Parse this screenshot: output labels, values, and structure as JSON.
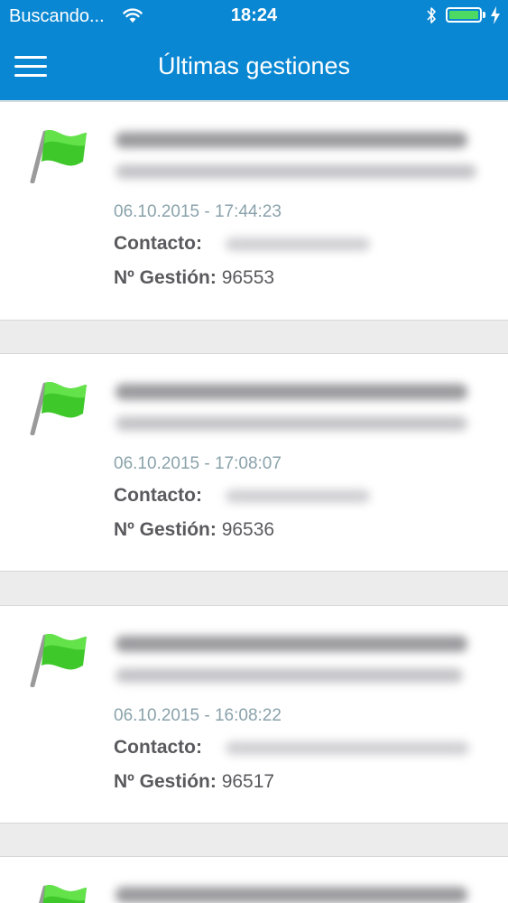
{
  "status_bar": {
    "carrier": "Buscando...",
    "time": "18:24",
    "wifi_icon": "wifi-icon",
    "bluetooth_icon": "bluetooth-icon",
    "battery_icon": "battery-icon",
    "charging_icon": "charging-bolt-icon",
    "battery_color": "#4cd964"
  },
  "nav": {
    "title": "Últimas gestiones",
    "menu_icon": "hamburger-menu-icon",
    "bar_color": "#0a87d2"
  },
  "items": [
    {
      "icon": "green-flag-icon",
      "date": "06.10.2015 - 17:44:23",
      "contact_label": "Contacto:",
      "gestion_label": "Nº Gestión:",
      "gestion_number": "96553"
    },
    {
      "icon": "green-flag-icon",
      "date": "06.10.2015 - 17:08:07",
      "contact_label": "Contacto:",
      "gestion_label": "Nº Gestión:",
      "gestion_number": "96536"
    },
    {
      "icon": "green-flag-icon",
      "date": "06.10.2015 - 16:08:22",
      "contact_label": "Contacto:",
      "gestion_label": "Nº Gestión:",
      "gestion_number": "96517"
    },
    {
      "icon": "green-flag-icon"
    }
  ]
}
